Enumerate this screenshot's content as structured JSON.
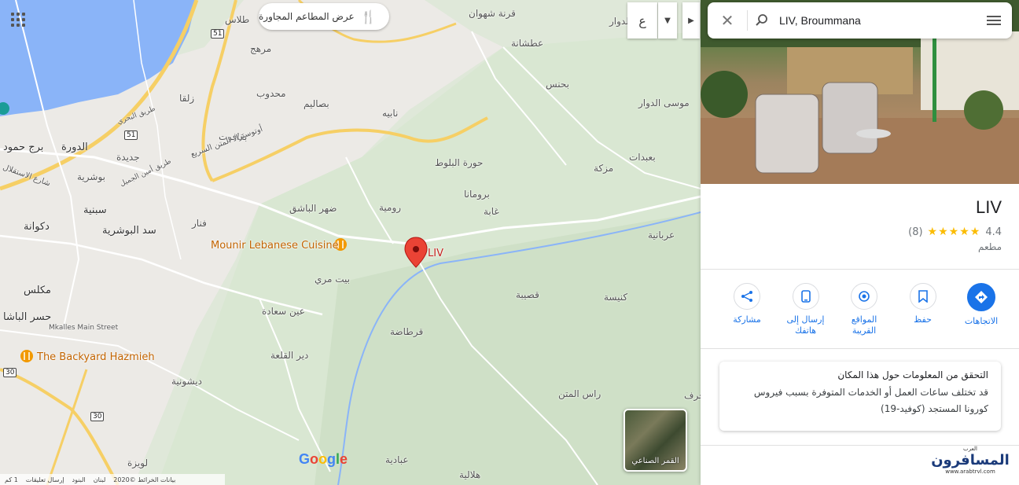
{
  "map": {
    "nearby_chip": "عرض المطاعم المجاورة",
    "lang_button": "ع",
    "satellite_label": "القمر الصناعي",
    "google_logo": "Google",
    "footer": [
      "بيانات الخرائط ©2020",
      "لبنان",
      "البنود",
      "إرسال تعليقات",
      "1 كم"
    ],
    "pin_label": "LIV",
    "pois": {
      "mounir": "Mounir Lebanese Cuisine",
      "backyard": "The Backyard Hazmieh"
    },
    "road_shields": [
      "51",
      "51",
      "30",
      "30"
    ],
    "places": {
      "p1": "قرنة شهوان",
      "p2": "الدوار",
      "p3": "عطشانة",
      "p4": "بحنس",
      "p5": "مرهج",
      "p6": "محدوب",
      "p7": "زلقا",
      "p8": "بصاليم",
      "p9": "نابيه",
      "p10": "موسى الدوار",
      "p11": "بقافوت",
      "p12": "جديدة",
      "p13": "الدورة",
      "p14": "برج حمود",
      "p15": "بوشرية",
      "p16": "حورة البلوط",
      "p17": "مزكة",
      "p18": "بعبدات",
      "p19": "برومانا",
      "p20": "ضهر الباشق",
      "p21": "رومية",
      "p22": "غابة",
      "p23": "سبنية",
      "p24": "دكوانة",
      "p25": "سد البوشرية",
      "p26": "فنار",
      "p27": "عربانية",
      "p28": "بيت مري",
      "p29": "عين سعادة",
      "p30": "قصيبة",
      "p31": "كنيسة",
      "p32": "مكلس",
      "p33": "حسر الباشا",
      "p34": "قرطاضة",
      "p35": "دير القلعة",
      "p36": "ديشونية",
      "p37": "راس المتن",
      "p38": "لويزة",
      "p39": "عبادية",
      "p40": "هلالية",
      "p41": "طلاس",
      "p42": "حرف"
    },
    "road_labels": {
      "r1": "أوتوستراد المتن السريع",
      "r2": "طريق أمين الجميل",
      "r3": "Mkalles Main Street",
      "r4": "طريق البحري",
      "r5": "شارع الاستقلال"
    }
  },
  "search": {
    "value": "LIV, Broummana"
  },
  "place": {
    "name": "LIV",
    "rating": "4.4",
    "reviews": "(8)",
    "stars": "★★★★★",
    "category": "مطعم"
  },
  "actions": [
    {
      "label": "الاتجاهات",
      "icon": "directions-icon"
    },
    {
      "label": "حفظ",
      "icon": "bookmark-icon"
    },
    {
      "label": "المواقع القريبة",
      "icon": "nearby-icon"
    },
    {
      "label": "إرسال إلى هاتفك",
      "icon": "phone-icon"
    },
    {
      "label": "مشاركة",
      "icon": "share-icon"
    }
  ],
  "notice": {
    "heading": "التحقق من المعلومات حول هذا المكان",
    "body": "قد تختلف ساعات العمل أو الخدمات المتوفرة بسبب فيروس كورونا المستجد (كوفيد-19)"
  },
  "watermark": {
    "title": "المسافرون",
    "sub": "العرب",
    "url": "www.arabtrvl.com"
  },
  "colors": {
    "accent": "#1a73e8",
    "pin": "#ea4335",
    "water": "#8ab4f8",
    "star": "#fbbc04",
    "road_yellow": "#f6cf65"
  }
}
